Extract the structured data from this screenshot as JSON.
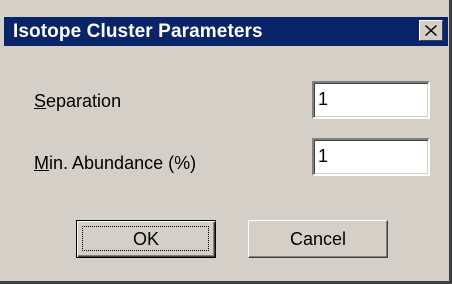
{
  "window": {
    "title": "Isotope Cluster Parameters",
    "close_glyph": "✕"
  },
  "form": {
    "separation": {
      "label_prefix": "",
      "label_accel": "S",
      "label_rest": "eparation",
      "value": "1"
    },
    "min_abundance": {
      "label_prefix": "",
      "label_accel": "M",
      "label_rest": "in. Abundance (%)",
      "value": "1"
    }
  },
  "buttons": {
    "ok_label": "OK",
    "cancel_label": "Cancel"
  }
}
